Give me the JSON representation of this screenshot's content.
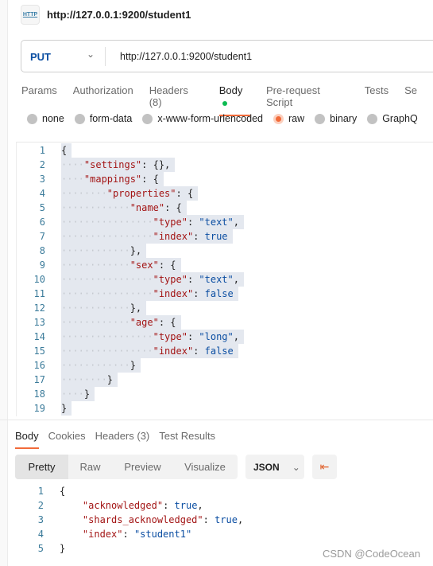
{
  "header": {
    "icon": "http-icon",
    "icon_text": "HTTP",
    "title": "http://127.0.0.1:9200/student1"
  },
  "request": {
    "method": "PUT",
    "url": "http://127.0.0.1:9200/student1"
  },
  "tabs": [
    "Params",
    "Authorization",
    "Headers (8)",
    "Body",
    "Pre-request Script",
    "Tests",
    "Se"
  ],
  "active_tab": "Body",
  "body_types": [
    "none",
    "form-data",
    "x-www-form-urlencoded",
    "raw",
    "binary",
    "GraphQ"
  ],
  "selected_body_type": "raw",
  "request_body": [
    {
      "n": "1",
      "indent": 0,
      "t": [
        [
          "p",
          "{"
        ]
      ]
    },
    {
      "n": "2",
      "indent": 4,
      "t": [
        [
          "k",
          "\"settings\""
        ],
        [
          "p",
          ": {},"
        ]
      ]
    },
    {
      "n": "3",
      "indent": 4,
      "t": [
        [
          "k",
          "\"mappings\""
        ],
        [
          "p",
          ": {"
        ]
      ]
    },
    {
      "n": "4",
      "indent": 8,
      "t": [
        [
          "k",
          "\"properties\""
        ],
        [
          "p",
          ": {"
        ]
      ]
    },
    {
      "n": "5",
      "indent": 12,
      "t": [
        [
          "k",
          "\"name\""
        ],
        [
          "p",
          ": {"
        ]
      ]
    },
    {
      "n": "6",
      "indent": 16,
      "t": [
        [
          "k",
          "\"type\""
        ],
        [
          "p",
          ": "
        ],
        [
          "s",
          "\"text\""
        ],
        [
          "p",
          ","
        ]
      ]
    },
    {
      "n": "7",
      "indent": 16,
      "t": [
        [
          "k",
          "\"index\""
        ],
        [
          "p",
          ": "
        ],
        [
          "b",
          "true"
        ]
      ]
    },
    {
      "n": "8",
      "indent": 12,
      "t": [
        [
          "p",
          "},"
        ]
      ]
    },
    {
      "n": "9",
      "indent": 12,
      "t": [
        [
          "k",
          "\"sex\""
        ],
        [
          "p",
          ": {"
        ]
      ]
    },
    {
      "n": "10",
      "indent": 16,
      "t": [
        [
          "k",
          "\"type\""
        ],
        [
          "p",
          ": "
        ],
        [
          "s",
          "\"text\""
        ],
        [
          "p",
          ","
        ]
      ]
    },
    {
      "n": "11",
      "indent": 16,
      "t": [
        [
          "k",
          "\"index\""
        ],
        [
          "p",
          ": "
        ],
        [
          "b",
          "false"
        ]
      ]
    },
    {
      "n": "12",
      "indent": 12,
      "t": [
        [
          "p",
          "},"
        ]
      ]
    },
    {
      "n": "13",
      "indent": 12,
      "t": [
        [
          "k",
          "\"age\""
        ],
        [
          "p",
          ": {"
        ]
      ]
    },
    {
      "n": "14",
      "indent": 16,
      "t": [
        [
          "k",
          "\"type\""
        ],
        [
          "p",
          ": "
        ],
        [
          "s",
          "\"long\""
        ],
        [
          "p",
          ","
        ]
      ]
    },
    {
      "n": "15",
      "indent": 16,
      "t": [
        [
          "k",
          "\"index\""
        ],
        [
          "p",
          ": "
        ],
        [
          "b",
          "false"
        ]
      ]
    },
    {
      "n": "16",
      "indent": 12,
      "t": [
        [
          "p",
          "}"
        ]
      ]
    },
    {
      "n": "17",
      "indent": 8,
      "t": [
        [
          "p",
          "}"
        ]
      ]
    },
    {
      "n": "18",
      "indent": 4,
      "t": [
        [
          "p",
          "}"
        ]
      ]
    },
    {
      "n": "19",
      "indent": 0,
      "t": [
        [
          "p",
          "}"
        ]
      ]
    }
  ],
  "response": {
    "tabs": [
      "Body",
      "Cookies",
      "Headers (3)",
      "Test Results"
    ],
    "views": [
      "Pretty",
      "Raw",
      "Preview",
      "Visualize"
    ],
    "active_view": "Pretty",
    "format": "JSON",
    "wrap_icon": "wrap-lines-icon",
    "lines": [
      {
        "n": "1",
        "indent": 0,
        "t": [
          [
            "p",
            "{"
          ]
        ]
      },
      {
        "n": "2",
        "indent": 4,
        "t": [
          [
            "k",
            "\"acknowledged\""
          ],
          [
            "p",
            ": "
          ],
          [
            "b",
            "true"
          ],
          [
            "p",
            ","
          ]
        ]
      },
      {
        "n": "3",
        "indent": 4,
        "t": [
          [
            "k",
            "\"shards_acknowledged\""
          ],
          [
            "p",
            ": "
          ],
          [
            "b",
            "true"
          ],
          [
            "p",
            ","
          ]
        ]
      },
      {
        "n": "4",
        "indent": 4,
        "t": [
          [
            "k",
            "\"index\""
          ],
          [
            "p",
            ": "
          ],
          [
            "s",
            "\"student1\""
          ]
        ]
      },
      {
        "n": "5",
        "indent": 0,
        "t": [
          [
            "p",
            "}"
          ]
        ]
      }
    ]
  },
  "watermark": "CSDN @CodeOcean",
  "colors": {
    "accent": "#f26b3a",
    "method": "#0b4ea2",
    "body_dot": "#0cbb52"
  }
}
